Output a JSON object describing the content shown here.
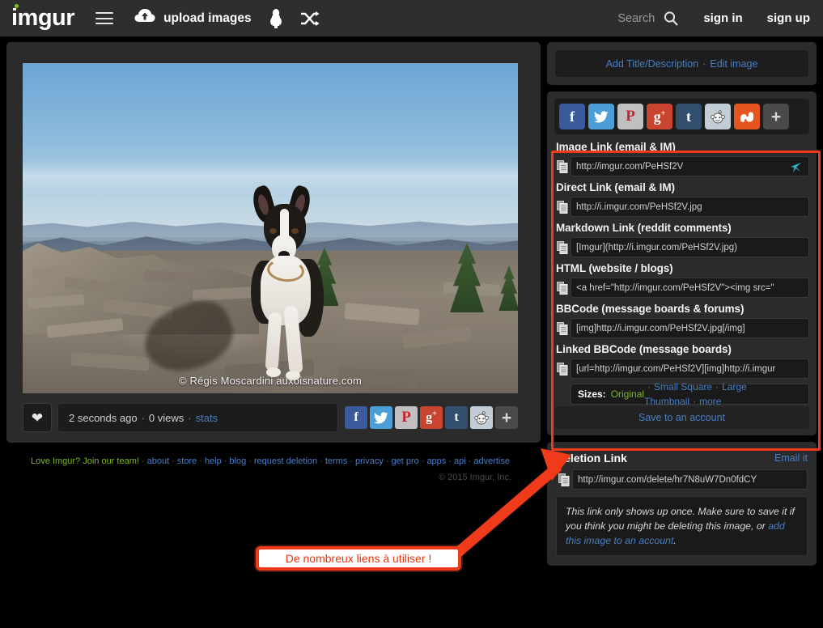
{
  "header": {
    "logo": "imgur",
    "menu_icon": "hamburger-menu-icon",
    "upload_label": "upload images",
    "upload_icon": "cloud-upload-icon",
    "meme_icon": "penguin-icon",
    "shuffle_icon": "shuffle-icon",
    "search_placeholder": "Search",
    "search_icon": "search-icon",
    "sign_in": "sign in",
    "sign_up": "sign up"
  },
  "image": {
    "watermark": "© Régis Moscardini auxoisnature.com",
    "alt": "Black and white border collie dog walking on a rocky mountain summit with blue sky",
    "favorite_icon": "heart-icon",
    "uploaded": "2 seconds ago",
    "views": "0 views",
    "stats_label": "stats",
    "separator": "·"
  },
  "share_buttons": [
    {
      "name": "facebook",
      "glyph": "f",
      "color": "#3b5a9b"
    },
    {
      "name": "twitter",
      "glyph": "ᵛ",
      "color": "#4b9ed6"
    },
    {
      "name": "pinterest",
      "glyph": "P",
      "color": "#c0c0c0"
    },
    {
      "name": "googleplus",
      "glyph": "g+",
      "color": "#c8442f"
    },
    {
      "name": "tumblr",
      "glyph": "t",
      "color": "#32506d"
    },
    {
      "name": "reddit",
      "glyph": "◉",
      "color": "#c3cdd6"
    },
    {
      "name": "stumbleupon",
      "glyph": "su",
      "color": "#e4551f"
    },
    {
      "name": "more",
      "glyph": "+",
      "color": "#4a4a4a"
    }
  ],
  "share_buttons_small": [
    {
      "name": "facebook",
      "glyph": "f",
      "color": "#3b5a9b"
    },
    {
      "name": "twitter",
      "glyph": "ᵛ",
      "color": "#4b9ed6"
    },
    {
      "name": "pinterest",
      "glyph": "P",
      "color": "#c0c0c0"
    },
    {
      "name": "googleplus",
      "glyph": "g+",
      "color": "#c8442f"
    },
    {
      "name": "tumblr",
      "glyph": "t",
      "color": "#32506d"
    },
    {
      "name": "reddit",
      "glyph": "◉",
      "color": "#c3cdd6"
    },
    {
      "name": "more",
      "glyph": "+",
      "color": "#4a4a4a"
    }
  ],
  "sidebar": {
    "title_bar": {
      "add_title": "Add Title/Description",
      "separator": "·",
      "edit_image": "Edit image"
    },
    "links": [
      {
        "label": "Image Link (email & IM)",
        "value": "http://imgur.com/PeHSf2V",
        "copy_icon": "copy-icon",
        "cursor_icon": "cursor-pointer-icon"
      },
      {
        "label": "Direct Link (email & IM)",
        "value": "http://i.imgur.com/PeHSf2V.jpg",
        "copy_icon": "copy-icon"
      },
      {
        "label": "Markdown Link (reddit comments)",
        "value": "[Imgur](http://i.imgur.com/PeHSf2V.jpg)",
        "copy_icon": "copy-icon"
      },
      {
        "label": "HTML (website / blogs)",
        "value": "<a href=\"http://imgur.com/PeHSf2V\"><img src=\"",
        "copy_icon": "copy-icon"
      },
      {
        "label": "BBCode (message boards & forums)",
        "value": "[img]http://i.imgur.com/PeHSf2V.jpg[/img]",
        "copy_icon": "copy-icon"
      },
      {
        "label": "Linked BBCode (message boards)",
        "value": "[url=http://imgur.com/PeHSf2V][img]http://i.imgur",
        "copy_icon": "copy-icon"
      }
    ],
    "sizes": {
      "label": "Sizes:",
      "original": "Original",
      "separator": "·",
      "options": [
        "Small Square",
        "Large Thumbnail",
        "more"
      ]
    },
    "save_account": "Save to an account",
    "deletion": {
      "title": "Deletion Link",
      "email_it": "Email it",
      "value": "http://imgur.com/delete/hr7N8uW7Dn0fdCY",
      "copy_icon": "copy-icon",
      "note_part1": "This link only shows up once. Make sure to save it if you think you might be deleting this image, or ",
      "note_link": "add this image to an account",
      "note_end": "."
    }
  },
  "footer": {
    "join": "Love Imgur? Join our team!",
    "separator": "·",
    "links": [
      "about",
      "store",
      "help",
      "blog",
      "request deletion",
      "terms",
      "privacy",
      "get pro",
      "apps",
      "api",
      "advertise"
    ],
    "copyright": "© 2015 Imgur, Inc."
  },
  "annotation": {
    "callout_text": "De nombreux liens à utiliser !",
    "color": "#f03b1a"
  }
}
